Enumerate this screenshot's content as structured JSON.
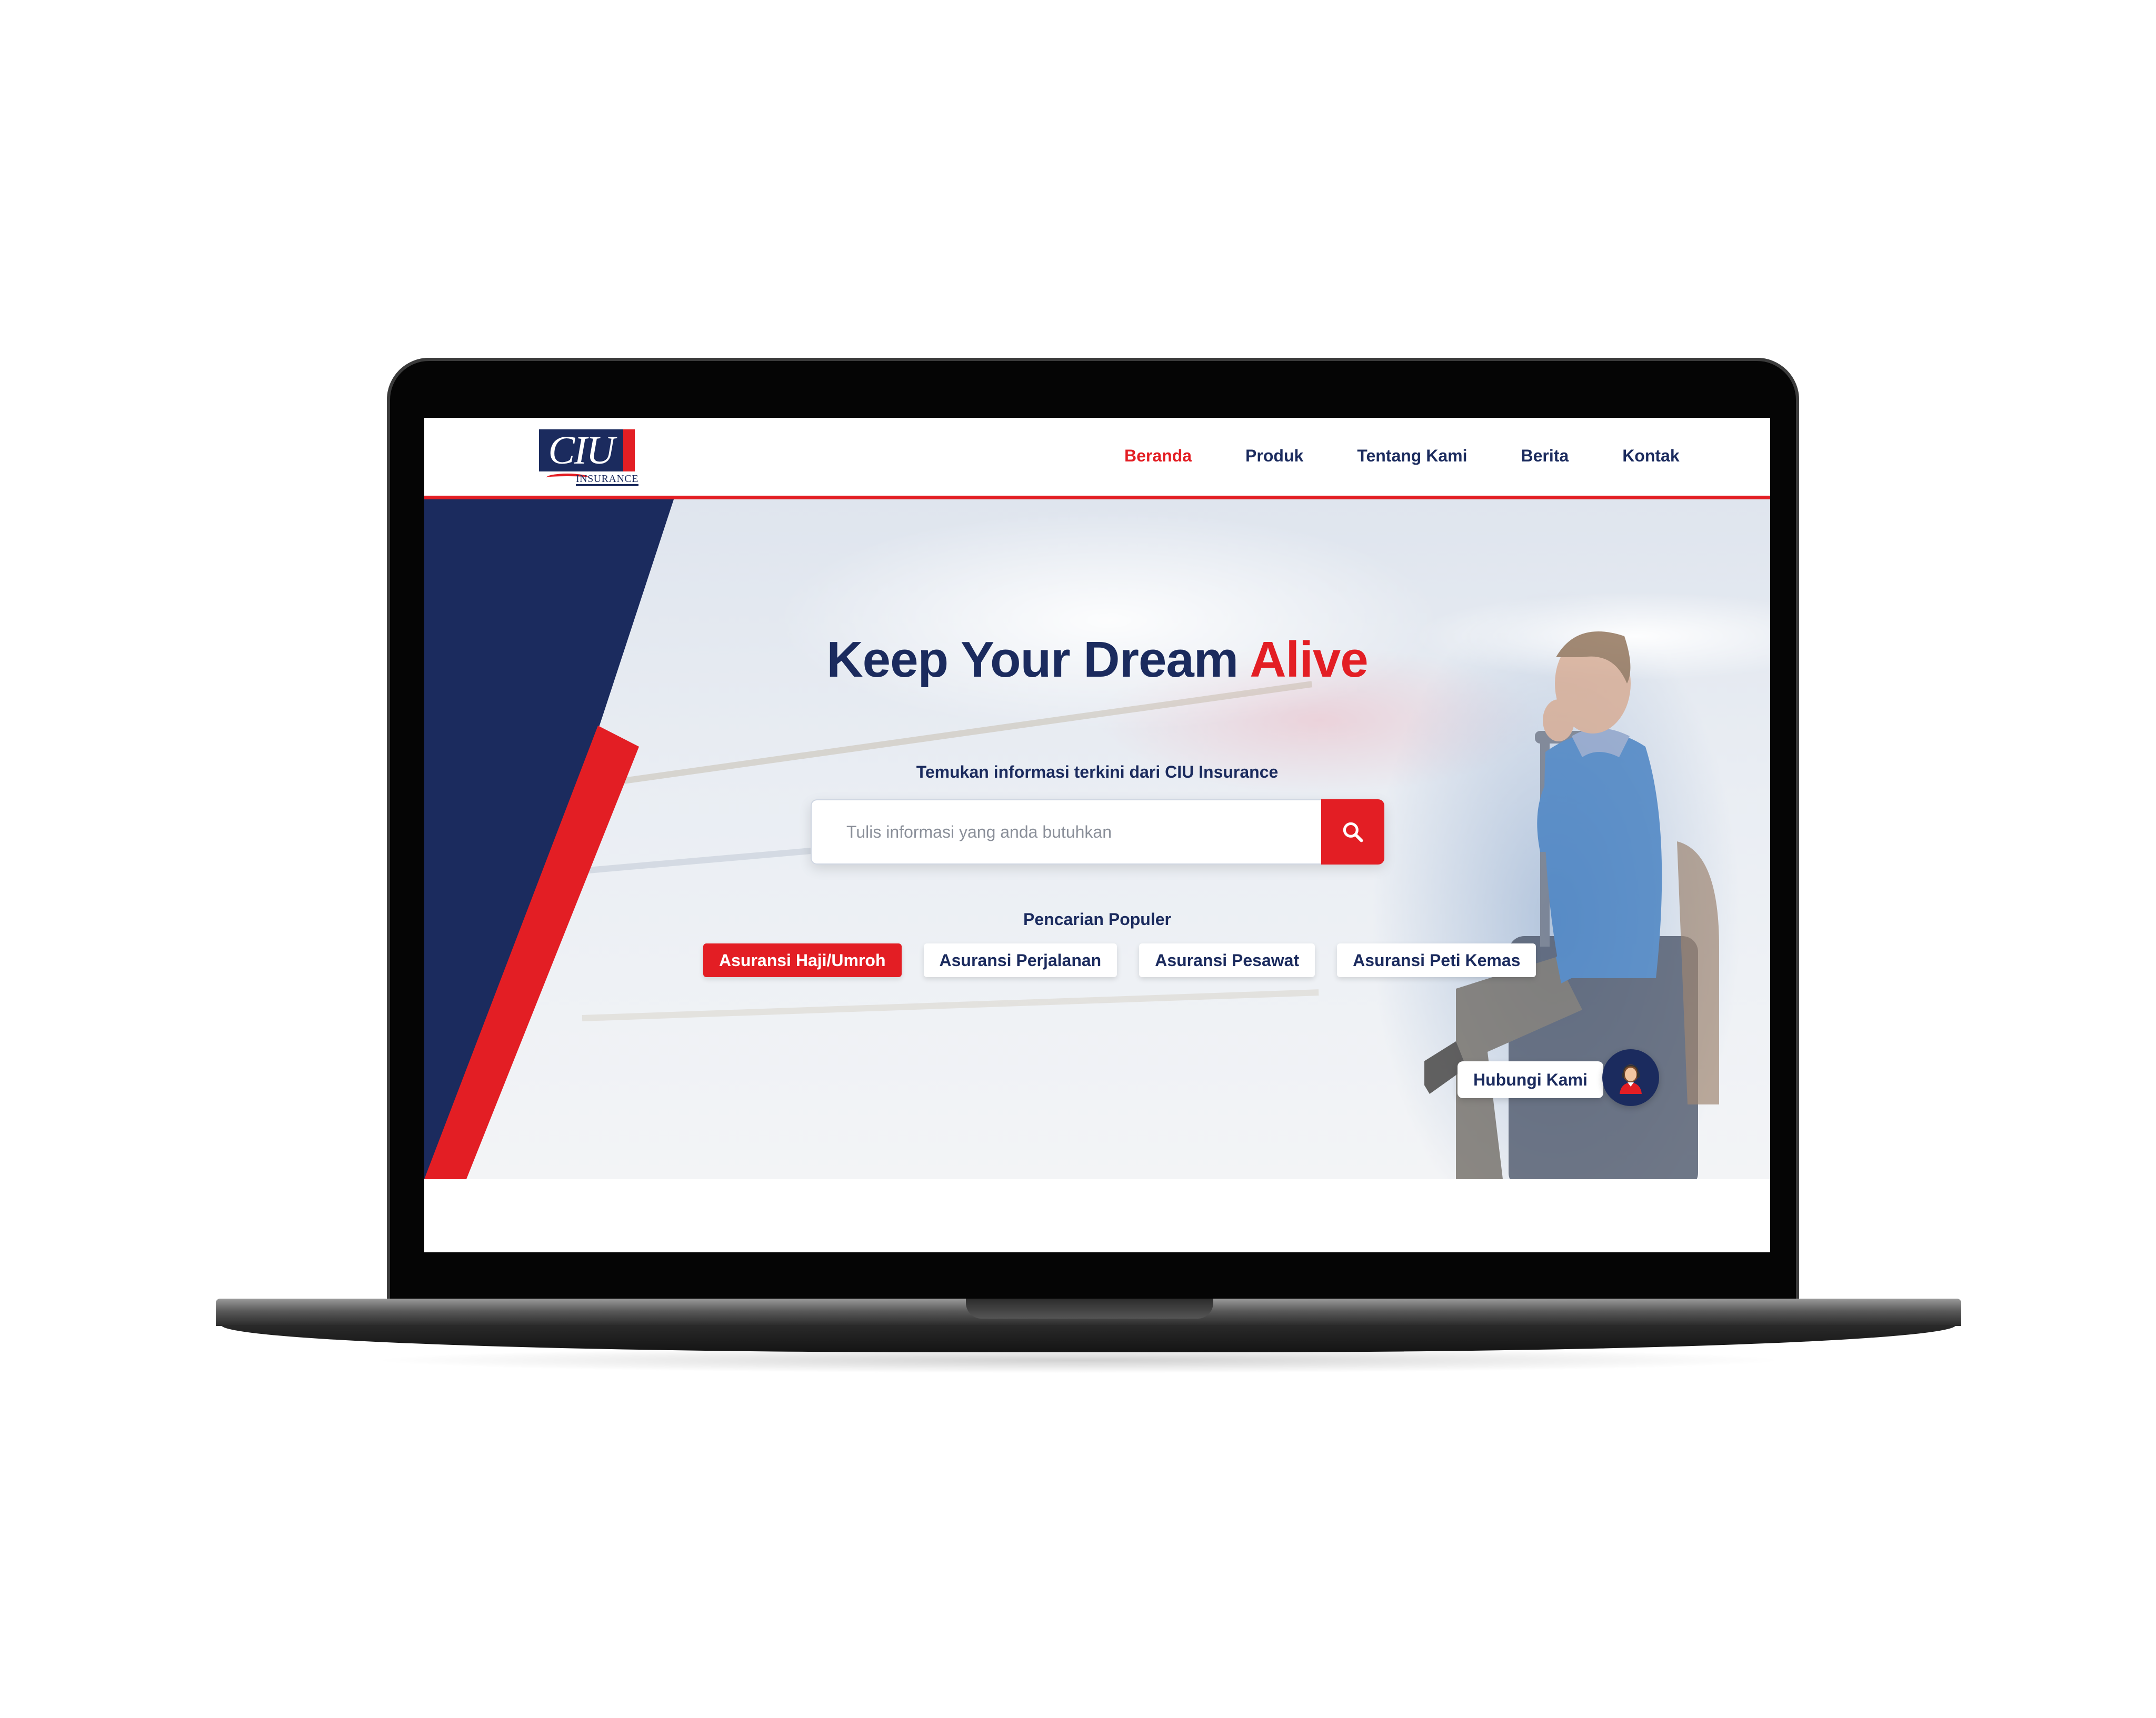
{
  "logo": {
    "brand": "CIU",
    "sub": "INSURANCE"
  },
  "nav": {
    "items": [
      {
        "label": "Beranda",
        "active": true
      },
      {
        "label": "Produk",
        "active": false
      },
      {
        "label": "Tentang Kami",
        "active": false
      },
      {
        "label": "Berita",
        "active": false
      },
      {
        "label": "Kontak",
        "active": false
      }
    ]
  },
  "hero": {
    "title_main": "Keep Your Dream ",
    "title_accent": "Alive",
    "subtitle": "Temukan informasi terkini dari CIU Insurance"
  },
  "search": {
    "placeholder": "Tulis informasi yang anda butuhkan",
    "value": ""
  },
  "popular": {
    "label": "Pencarian Populer",
    "chips": [
      {
        "label": "Asuransi Haji/Umroh",
        "active": true
      },
      {
        "label": "Asuransi Perjalanan",
        "active": false
      },
      {
        "label": "Asuransi Pesawat",
        "active": false
      },
      {
        "label": "Asuransi Peti Kemas",
        "active": false
      }
    ]
  },
  "contact": {
    "label": "Hubungi Kami"
  },
  "colors": {
    "navy": "#1b2b5e",
    "red": "#e31e24",
    "white": "#ffffff"
  },
  "icons": {
    "search": "search-icon",
    "contact": "customer-service-avatar-icon"
  }
}
